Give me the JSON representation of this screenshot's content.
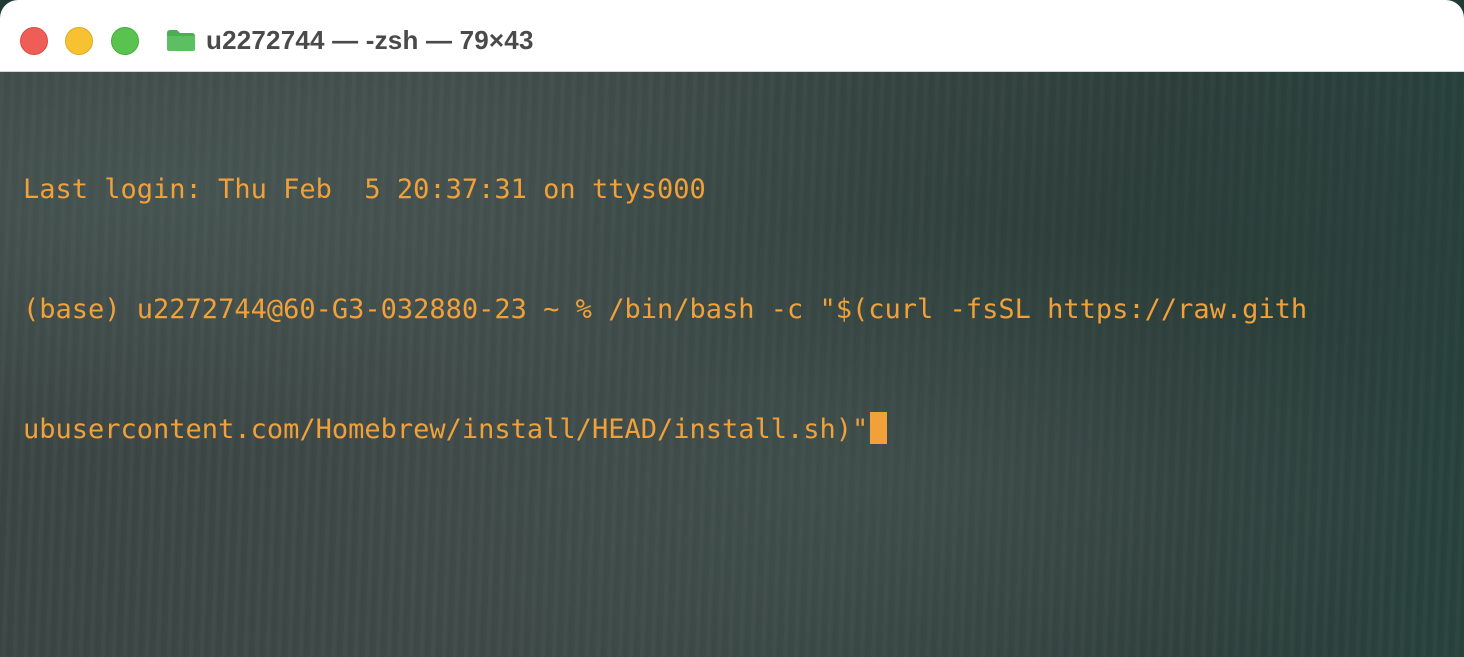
{
  "window": {
    "title": "u2272744 — -zsh — 79×43",
    "folder_icon": "folder-icon",
    "folder_color": "#4caf50"
  },
  "traffic_lights": {
    "close_color": "#ee5e57",
    "minimize_color": "#f6c231",
    "maximize_color": "#5ac24e"
  },
  "terminal": {
    "text_color": "#f0a13a",
    "lines": [
      "Last login: Thu Feb  5 20:37:31 on ttys000",
      "(base) u2272744@60-G3-032880-23 ~ % /bin/bash -c \"$(curl -fsSL https://raw.gith",
      "ubusercontent.com/Homebrew/install/HEAD/install.sh)\""
    ]
  }
}
